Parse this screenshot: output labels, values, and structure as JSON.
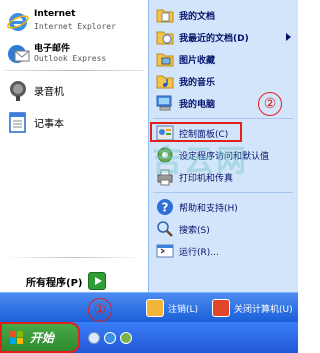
{
  "left": {
    "pinned": [
      {
        "title": "Internet",
        "subtitle": "Internet Explorer",
        "icon": "internet-explorer-icon"
      },
      {
        "title": "电子邮件",
        "subtitle": "Outlook Express",
        "icon": "outlook-express-icon"
      }
    ],
    "recent": [
      {
        "label": "录音机",
        "icon": "sound-recorder-icon"
      },
      {
        "label": "记事本",
        "icon": "notepad-icon"
      }
    ],
    "all_programs": "所有程序(P)"
  },
  "right": {
    "items": [
      {
        "label": "我的文档",
        "icon": "my-documents-icon",
        "bold": true
      },
      {
        "label": "我最近的文档(D)",
        "icon": "recent-documents-icon",
        "bold": true,
        "submenu": true
      },
      {
        "label": "图片收藏",
        "icon": "my-pictures-icon",
        "bold": true
      },
      {
        "label": "我的音乐",
        "icon": "my-music-icon",
        "bold": true
      },
      {
        "label": "我的电脑",
        "icon": "my-computer-icon",
        "bold": true
      },
      {
        "label": "控制面板(C)",
        "icon": "control-panel-icon",
        "bold": false
      },
      {
        "label": "设定程序访问和默认值",
        "icon": "program-defaults-icon",
        "bold": false
      },
      {
        "label": "打印机和传真",
        "icon": "printers-faxes-icon",
        "bold": false
      },
      {
        "label": "帮助和支持(H)",
        "icon": "help-support-icon",
        "bold": false
      },
      {
        "label": "搜索(S)",
        "icon": "search-icon",
        "bold": false
      },
      {
        "label": "运行(R)...",
        "icon": "run-icon",
        "bold": false
      }
    ]
  },
  "bottom": {
    "logoff": "注销(L)",
    "shutdown": "关闭计算机(U)"
  },
  "taskbar": {
    "start": "开始"
  },
  "annotations": {
    "callout_1": "①",
    "callout_2": "②"
  },
  "watermark": "吉云网",
  "colors": {
    "right_pane_bg": "#d3e5fa",
    "bottom_bar": "#2b6fe6",
    "start_green": "#3a9c3a",
    "highlight_red": "#e0201b"
  }
}
